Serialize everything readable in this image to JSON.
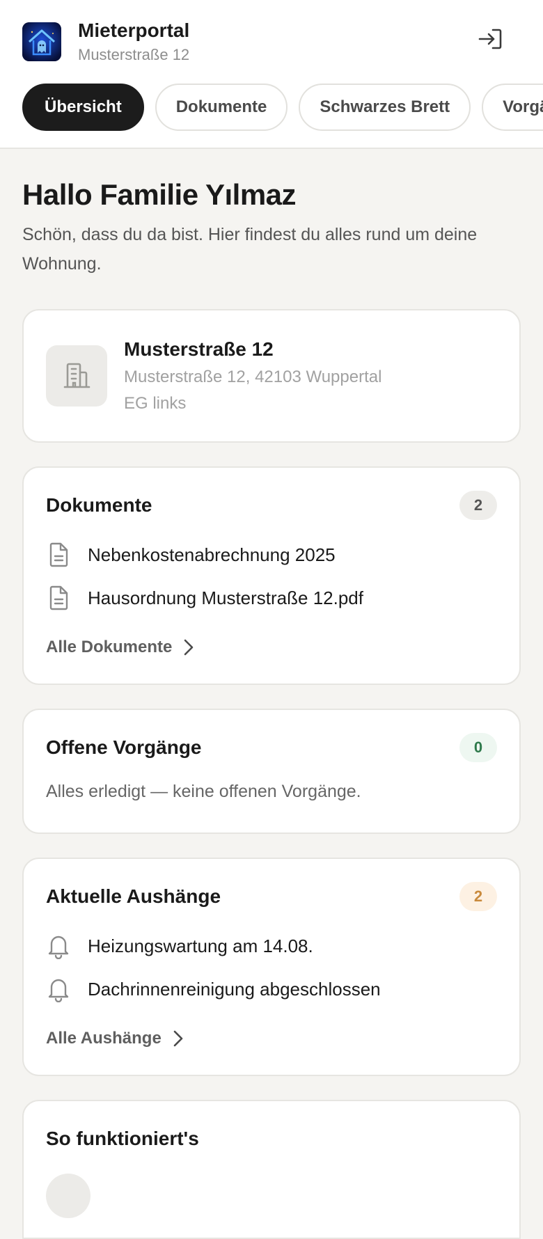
{
  "header": {
    "app_title": "Mieterportal",
    "app_subtitle": "Musterstraße 12",
    "logo_icon": "house-ghost-logo-icon",
    "logout_icon": "logout-icon"
  },
  "tabs": [
    {
      "label": "Übersicht",
      "active": true
    },
    {
      "label": "Dokumente",
      "active": false
    },
    {
      "label": "Schwarzes Brett",
      "active": false
    },
    {
      "label": "Vorgänge",
      "active": false
    }
  ],
  "greeting": {
    "title": "Hallo Familie Yılmaz",
    "text": "Schön, dass du da bist. Hier findest du alles rund um deine Wohnung."
  },
  "property": {
    "icon": "building-icon",
    "name": "Musterstraße 12",
    "address": "Musterstraße 12, 42103 Wuppertal",
    "unit": "EG links"
  },
  "documents": {
    "title": "Dokumente",
    "count": "2",
    "items": [
      {
        "icon": "document-icon",
        "label": "Nebenkostenabrechnung 2025"
      },
      {
        "icon": "document-icon",
        "label": "Hausordnung Musterstraße 12.pdf"
      }
    ],
    "link_label": "Alle Dokumente"
  },
  "processes": {
    "title": "Offene Vorgänge",
    "count": "0",
    "empty_text": "Alles erledigt — keine offenen Vorgänge."
  },
  "notices": {
    "title": "Aktuelle Aushänge",
    "count": "2",
    "items": [
      {
        "icon": "bell-icon",
        "label": "Heizungswartung am 14.08."
      },
      {
        "icon": "bell-icon",
        "label": "Dachrinnenreinigung abgeschlossen"
      }
    ],
    "link_label": "Alle Aushänge"
  },
  "howto": {
    "title": "So funktioniert's"
  },
  "colors": {
    "background": "#f5f4f1",
    "active_tab": "#1c1c1c",
    "badge_green": "#2f7a4c",
    "badge_orange": "#c98a3c",
    "logo_bg": "#0b1742"
  }
}
